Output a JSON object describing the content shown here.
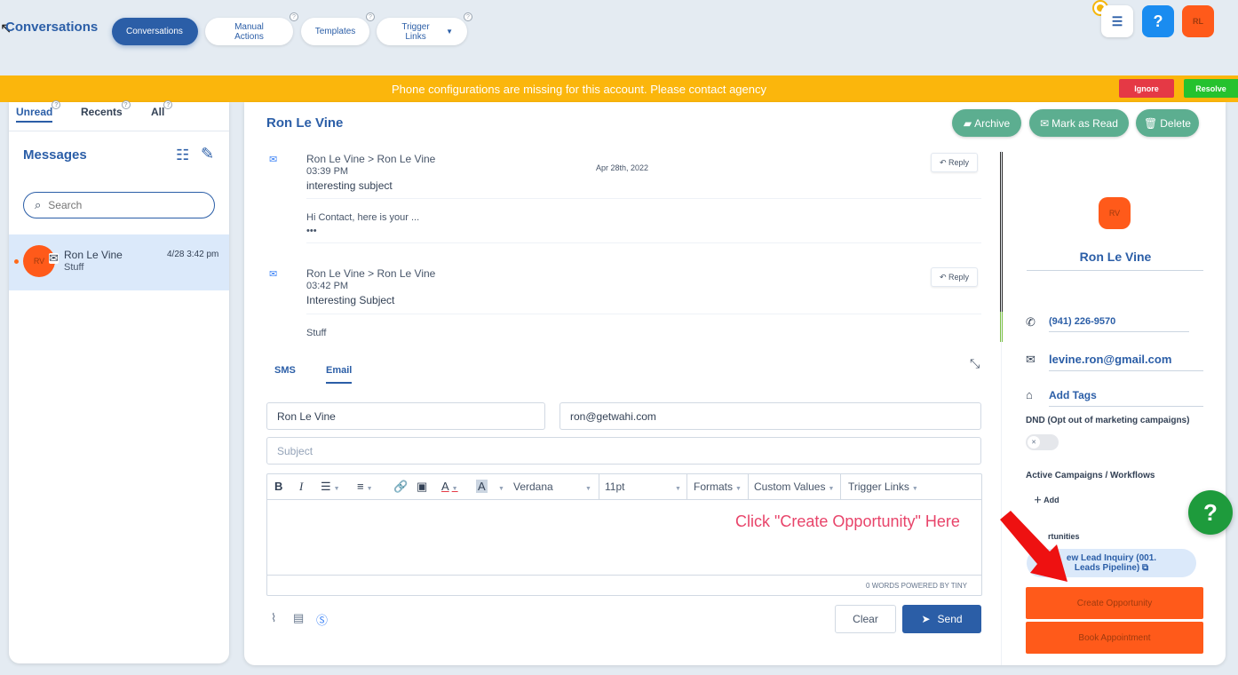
{
  "header": {
    "app_title": "Conversations",
    "tabs": [
      {
        "label": "Conversations",
        "active": true
      },
      {
        "label": "Manual Actions"
      },
      {
        "label": "Templates"
      },
      {
        "label": "Trigger Links"
      }
    ],
    "help_label": "?",
    "user_initials": "RL",
    "help_badge": "?"
  },
  "banner": {
    "message": "Phone configurations are missing for this account. Please contact agency",
    "ignore_label": "Ignore",
    "resolve_label": "Resolve",
    "color": "#fbb60c"
  },
  "sidebar": {
    "filter_tabs": [
      "Unread",
      "Recents",
      "All"
    ],
    "title": "Messages",
    "search_placeholder": "Search",
    "conversations": [
      {
        "initials": "RV",
        "name": "Ron Le Vine",
        "preview": "Stuff",
        "time": "4/28 3:42 pm"
      }
    ]
  },
  "conversation": {
    "contact_name": "Ron Le Vine",
    "actions": {
      "archive": "Archive",
      "mark_read": "Mark as Read",
      "delete": "Delete"
    },
    "messages": [
      {
        "from": "Ron Le Vine > Ron Le Vine",
        "time": "03:39 PM",
        "subject": "interesting subject",
        "body": "Hi Contact, here is your ...",
        "ellipsis": "•••",
        "date": "Apr 28th, 2022",
        "reply": "Reply"
      },
      {
        "from": "Ron Le Vine > Ron Le Vine",
        "time": "03:42 PM",
        "subject": "Interesting Subject",
        "body": "Stuff",
        "reply": "Reply"
      }
    ]
  },
  "composer": {
    "tabs": {
      "sms": "SMS",
      "email": "Email"
    },
    "from_name": "Ron Le Vine",
    "from_email": "ron@getwahi.com",
    "subject_placeholder": "Subject",
    "toolbar": {
      "bold": "B",
      "italic": "I",
      "font": "Verdana",
      "size": "11pt",
      "formats": "Formats",
      "custom_values": "Custom Values",
      "trigger_links": "Trigger Links"
    },
    "status": "0 WORDS POWERED BY TINY",
    "clear_label": "Clear",
    "send_label": "Send"
  },
  "annotation": "Click \"Create Opportunity\" Here",
  "contact_panel": {
    "initials": "RV",
    "name": "Ron Le Vine",
    "phone": "(941) 226-9570",
    "email": "levine.ron@gmail.com",
    "add_tags": "Add Tags",
    "dnd_label": "DND (Opt out of marketing campaigns)",
    "campaigns_label": "Active Campaigns / Workflows",
    "add_label": "Add",
    "opportunities_label": "rtunities",
    "opportunity_line1": "ew Lead Inquiry (001.",
    "opportunity_line2": "Leads Pipeline)",
    "create_opportunity": "Create Opportunity",
    "book_appointment": "Book Appointment"
  },
  "floating_help": "?",
  "colors": {
    "brand_blue": "#2b5ea7",
    "accent_orange": "#ff5a1a",
    "action_green": "#5cae90",
    "annotation_pink": "#e8446a"
  }
}
